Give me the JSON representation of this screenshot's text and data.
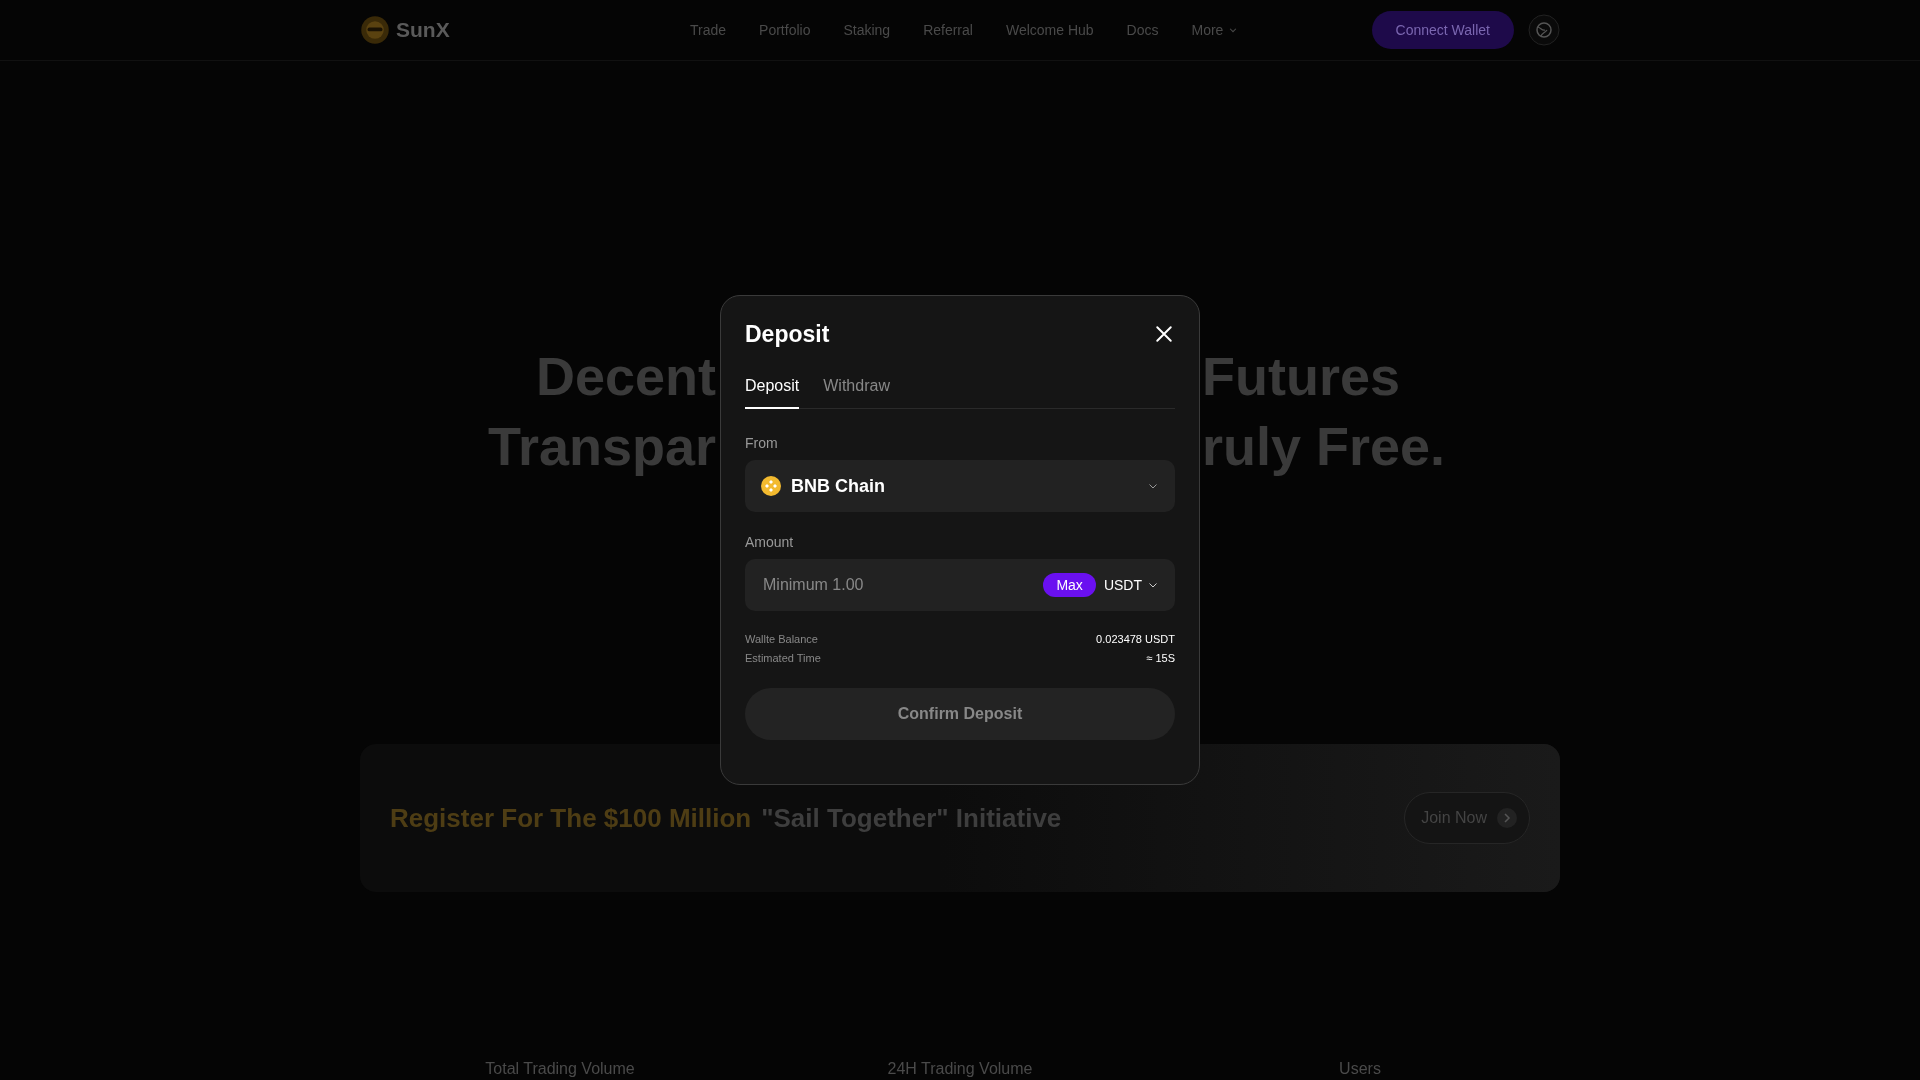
{
  "header": {
    "logo": "SunX",
    "nav": [
      {
        "label": "Trade",
        "kind": "link"
      },
      {
        "label": "Portfolio",
        "kind": "link"
      },
      {
        "label": "Staking",
        "kind": "link"
      },
      {
        "label": "Referral",
        "kind": "link"
      },
      {
        "label": "Welcome Hub",
        "kind": "link"
      },
      {
        "label": "Docs",
        "kind": "link"
      },
      {
        "label": "More",
        "kind": "dropdown"
      }
    ],
    "connect_button": "Connect Wallet"
  },
  "hero": {
    "lines": [
      {
        "left": "Decent",
        "right": "Futures"
      },
      {
        "left": "Transpar",
        "right": "ruly Free."
      }
    ]
  },
  "banner": {
    "highlight": "Register For The $100 Million",
    "text": "\"Sail Together\" Initiative",
    "button": "Join Now"
  },
  "stats": [
    {
      "label": "Total Trading Volume"
    },
    {
      "label": "24H Trading Volume"
    },
    {
      "label": "Users"
    }
  ],
  "modal": {
    "title": "Deposit",
    "tabs": [
      {
        "label": "Deposit",
        "selected": true
      },
      {
        "label": "Withdraw",
        "selected": false
      }
    ],
    "from_label": "From",
    "chain": "BNB Chain",
    "amount_label": "Amount",
    "amount_placeholder": "Minimum 1.00",
    "max_button": "Max",
    "token": "USDT",
    "details": [
      {
        "label": "Wallte Balance",
        "value": "0.023478 USDT"
      },
      {
        "label": "Estimated Time",
        "value": "≈ 15S"
      }
    ],
    "confirm_button": "Confirm Deposit"
  }
}
